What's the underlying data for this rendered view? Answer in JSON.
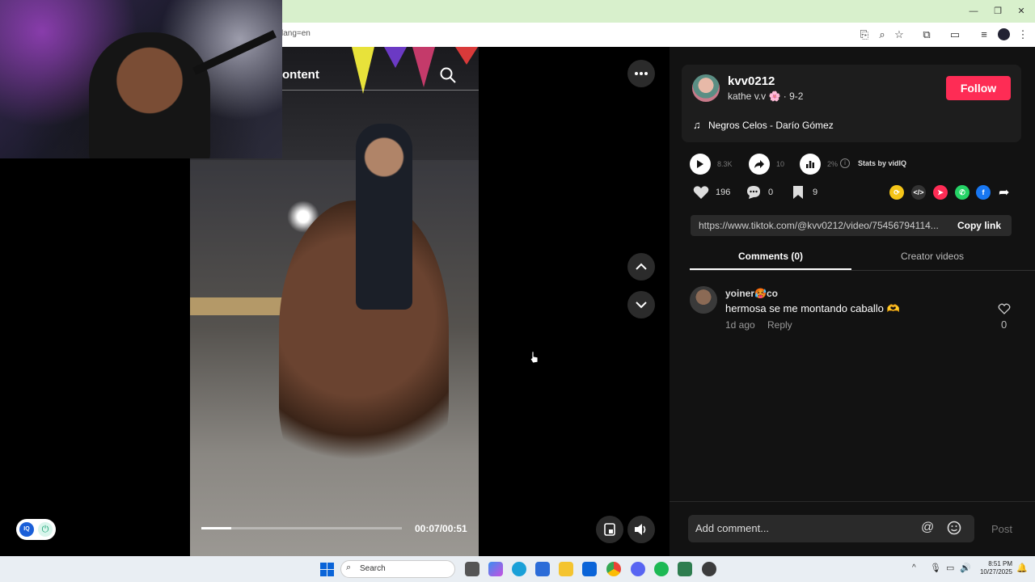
{
  "browser": {
    "url_fragment": "lang=en"
  },
  "search": {
    "text": "ontent"
  },
  "video": {
    "time": "00:07/00:51",
    "progress": 0.15
  },
  "author": {
    "username": "kvv0212",
    "nickname": "kathe v.v 🌸 · 9-2",
    "follow_label": "Follow"
  },
  "music": {
    "icon": "music-note-icon",
    "title": "Negros Celos - Darío Gómez"
  },
  "stats": {
    "views": "8.3K",
    "shares": "10",
    "engagement": "2%",
    "by_label": "Stats by vidIQ"
  },
  "actions": {
    "likes": "196",
    "comments": "0",
    "saves": "9"
  },
  "link": {
    "url": "https://www.tiktok.com/@kvv0212/video/75456794114...",
    "copy_label": "Copy link"
  },
  "tabs": [
    {
      "label": "Comments (0)",
      "active": true
    },
    {
      "label": "Creator videos",
      "active": false
    }
  ],
  "comments": [
    {
      "user": "yoiner🥵co",
      "text": "hermosa se me montando caballo 🫶",
      "time": "1d ago",
      "reply_label": "Reply",
      "likes": "0"
    }
  ],
  "composer": {
    "placeholder": "Add comment...",
    "post_label": "Post"
  },
  "taskbar": {
    "search_label": "Search",
    "time": "8:51 PM",
    "date": "10/27/2025"
  },
  "colors": {
    "accent": "#fe2c55",
    "panel": "#121212",
    "titlebar": "#d8f0cc"
  }
}
